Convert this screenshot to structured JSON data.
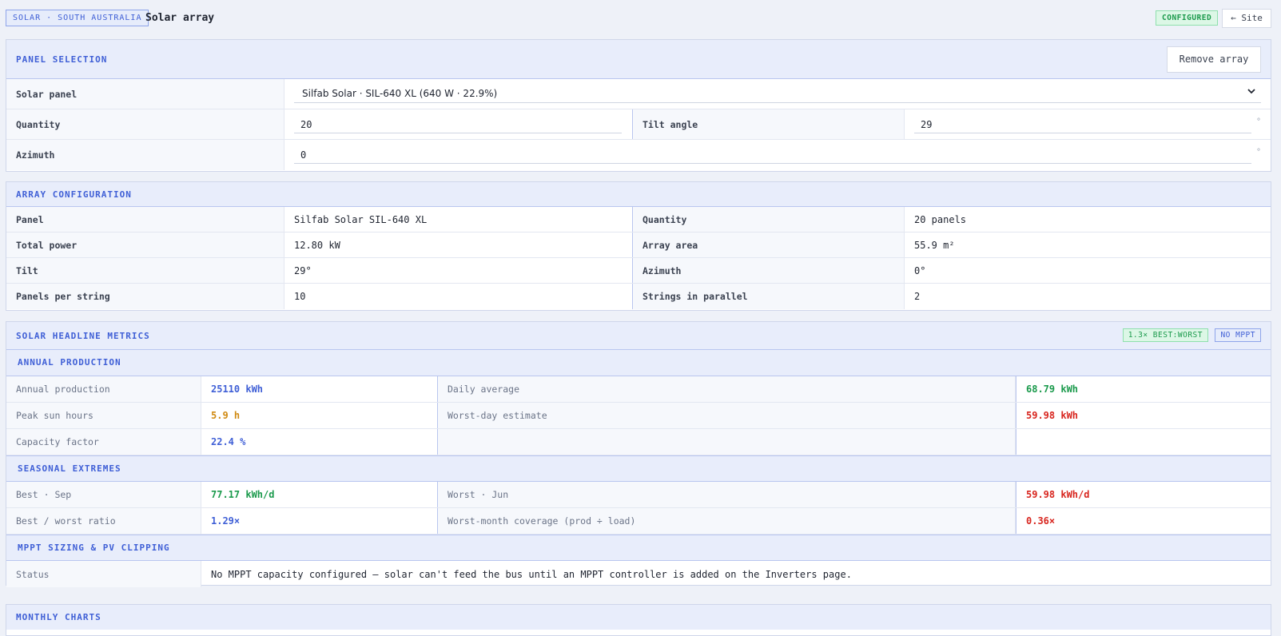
{
  "header": {
    "breadcrumb": "SOLAR · SOUTH AUSTRALIA",
    "title": "Solar array",
    "status_badge": "CONFIGURED",
    "back_button": "← Site"
  },
  "panel_selection": {
    "title": "PANEL SELECTION",
    "remove_button": "Remove array",
    "solar_panel_label": "Solar panel",
    "solar_panel_value": "Silfab Solar · SIL-640 XL (640 W · 22.9%)",
    "quantity_label": "Quantity",
    "quantity_value": "20",
    "tilt_label": "Tilt angle",
    "tilt_value": "29",
    "tilt_unit": "°",
    "azimuth_label": "Azimuth",
    "azimuth_value": "0",
    "azimuth_unit": "°"
  },
  "array_config": {
    "title": "ARRAY CONFIGURATION",
    "rows": [
      {
        "l1": "Panel",
        "v1": "Silfab Solar SIL-640 XL",
        "l2": "Quantity",
        "v2": "20 panels"
      },
      {
        "l1": "Total power",
        "v1": "12.80 kW",
        "l2": "Array area",
        "v2": "55.9 m²"
      },
      {
        "l1": "Tilt",
        "v1": "29°",
        "l2": "Azimuth",
        "v2": "0°"
      },
      {
        "l1": "Panels per string",
        "v1": "10",
        "l2": "Strings in parallel",
        "v2": "2"
      }
    ]
  },
  "metrics": {
    "title": "SOLAR HEADLINE METRICS",
    "tag_best": "1.3× BEST:WORST",
    "tag_mppt": "NO MPPT",
    "annual": {
      "title": "ANNUAL PRODUCTION",
      "annual_production_label": "Annual production",
      "annual_production_value": "25110 kWh",
      "daily_average_label": "Daily average",
      "daily_average_value": "68.79 kWh",
      "peak_sun_label": "Peak sun hours",
      "peak_sun_value": "5.9 h",
      "worst_day_label": "Worst-day estimate",
      "worst_day_value": "59.98 kWh",
      "capacity_label": "Capacity factor",
      "capacity_value": "22.4 %"
    },
    "seasonal": {
      "title": "SEASONAL EXTREMES",
      "best_label": "Best · Sep",
      "best_value": "77.17 kWh/d",
      "worst_label": "Worst · Jun",
      "worst_value": "59.98 kWh/d",
      "ratio_label": "Best / worst ratio",
      "ratio_value": "1.29×",
      "coverage_label": "Worst-month coverage (prod ÷ load)",
      "coverage_value": "0.36×"
    },
    "mppt": {
      "title": "MPPT SIZING & PV CLIPPING",
      "status_label": "Status",
      "status_value": "No MPPT capacity configured — solar can't feed the bus until an MPPT controller is added on the Inverters page."
    }
  },
  "monthly_charts": {
    "title": "MONTHLY CHARTS"
  },
  "colors": {
    "accent": "#3f5fd6",
    "good": "#1b9a4c",
    "warn": "#d08a12",
    "bad": "#d8261f"
  }
}
